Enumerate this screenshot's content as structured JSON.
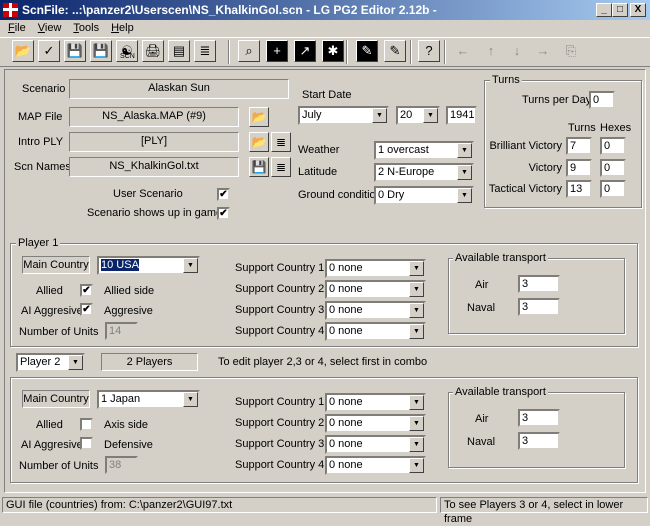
{
  "window": {
    "title": "ScnFile: ..:\\panzer2\\Userscen\\NS_KhalkinGol.scn   - LG PG2 Editor 2.12b -",
    "minimize": "_",
    "maximize": "□",
    "close": "X"
  },
  "menu": [
    "File",
    "View",
    "Tools",
    "Help"
  ],
  "toolbar": [
    "open-folder-icon",
    "check-icon",
    "save-icon",
    "save-as-icon",
    "scn-yin-yang-icon",
    "print-icon",
    "book-icon",
    "sort-list-icon",
    "find-icon",
    "add-unit-icon",
    "map-export-icon",
    "units-icon",
    "deploy-icon",
    "edit-disabled-icon",
    "help-icon",
    "arrow-left-icon",
    "arrow-up-icon",
    "arrow-down-icon",
    "arrow-right-icon",
    "copy-icon"
  ],
  "toolbar_scn_label": "SCN",
  "scenario": {
    "label": "Scenario",
    "value": "Alaskan Sun"
  },
  "map_file": {
    "label": "MAP  File",
    "value": "NS_Alaska.MAP (#9)"
  },
  "intro_ply": {
    "label": "Intro PLY",
    "value": "[PLY]"
  },
  "scn_names": {
    "label": "Scn Names",
    "value": "NS_KhalkinGol.txt"
  },
  "user_scenario": {
    "label": "User Scenario",
    "checked": "✔"
  },
  "shows_up": {
    "label": "Scenario shows up in game",
    "checked": "✔"
  },
  "start_date": {
    "label": "Start Date",
    "month": "July",
    "day": "20",
    "year": "1941"
  },
  "weather": {
    "label": "Weather",
    "value": "1   overcast"
  },
  "latitude": {
    "label": "Latitude",
    "value": "2  N-Europe"
  },
  "ground": {
    "label": "Ground condition",
    "value": "0   Dry"
  },
  "turns": {
    "title": "Turns",
    "per_day_label": "Turns per Day",
    "per_day": "0",
    "col_turns": "Turns",
    "col_hexes": "Hexes",
    "rows": [
      {
        "label": "Brilliant  Victory",
        "turns": "7",
        "hexes": "0"
      },
      {
        "label": "Victory",
        "turns": "9",
        "hexes": "0"
      },
      {
        "label": "Tactical  Victory",
        "turns": "13",
        "hexes": "0"
      }
    ]
  },
  "support_labels": [
    "Support  Country 1",
    "Support  Country 2",
    "Support  Country 3",
    "Support  Country 4"
  ],
  "player1": {
    "title": "Player 1",
    "main_country_label": "Main Country",
    "main_country": "10 USA",
    "allied_label": "Allied",
    "allied": "✔",
    "allied_side": "Allied side",
    "ai_label": "AI Aggresive",
    "ai": "✔",
    "ai_text": "Aggresive",
    "units_label": "Number of  Units",
    "units": "14",
    "support": [
      "0 none",
      "0 none",
      "0 none",
      "0 none"
    ],
    "transport": {
      "title": "Available transport",
      "air_label": "Air",
      "air": "3",
      "naval_label": "Naval",
      "naval": "3"
    }
  },
  "player_select": {
    "value": "Player  2",
    "count": "2 Players",
    "hint": "To edit player 2,3 or 4, select first in combo"
  },
  "player2": {
    "main_country_label": "Main Country",
    "main_country": "1  Japan",
    "allied_label": "Allied",
    "allied": "",
    "allied_side": "Axis side",
    "ai_label": "AI Aggresive",
    "ai": "",
    "ai_text": "Defensive",
    "units_label": "Number of  Units",
    "units": "38",
    "support": [
      "0 none",
      "0 none",
      "0 none",
      "0 none"
    ],
    "transport": {
      "title": "Available transport",
      "air_label": "Air",
      "air": "3",
      "naval_label": "Naval",
      "naval": "3"
    }
  },
  "status": {
    "left": "GUI file (countries) from: C:\\panzer2\\GUI97.txt",
    "right": "To see Players 3 or 4, select in lower frame"
  }
}
